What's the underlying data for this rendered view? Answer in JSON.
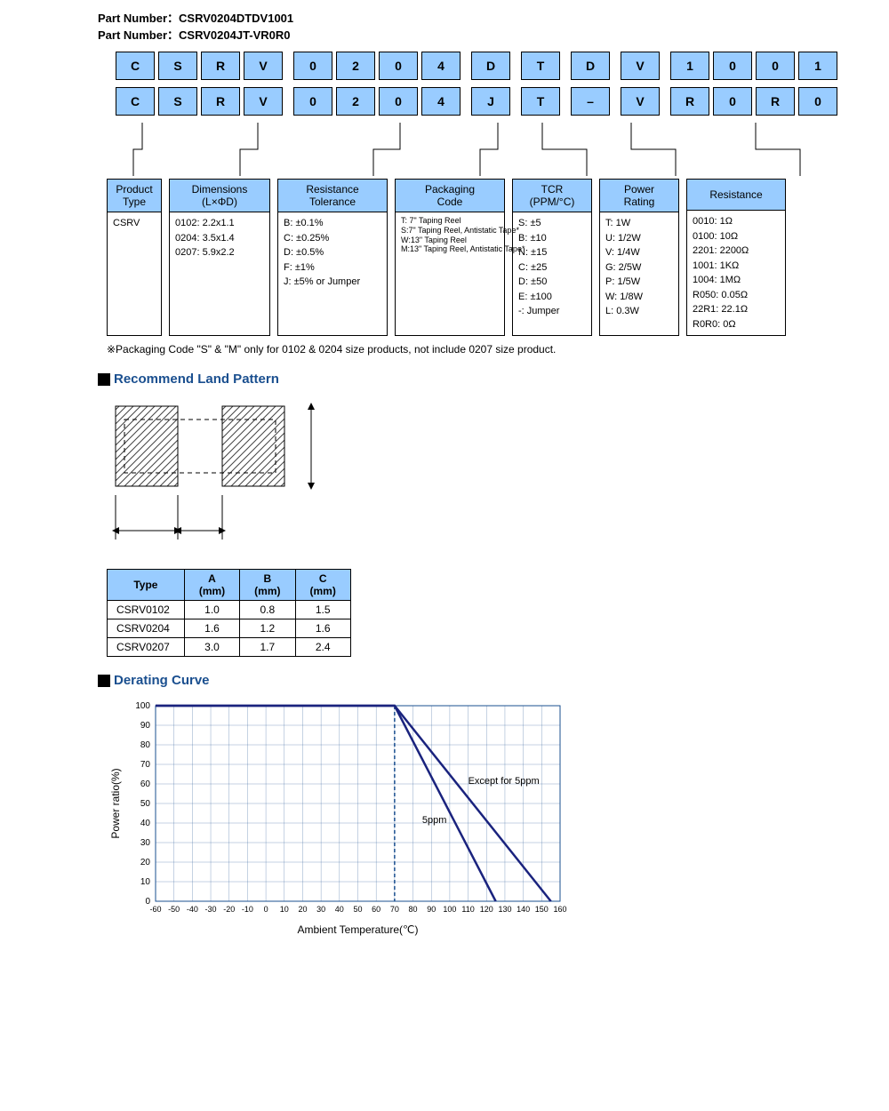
{
  "part1_label": "Part Number：",
  "part1_value": "CSRV0204DTDV1001",
  "part2_label": "Part Number：",
  "part2_value": "CSRV0204JT-VR0R0",
  "code_row1": [
    "C",
    "S",
    "R",
    "V",
    "0",
    "2",
    "0",
    "4",
    "D",
    "T",
    "D",
    "V",
    "1",
    "0",
    "0",
    "1"
  ],
  "code_row2": [
    "C",
    "S",
    "R",
    "V",
    "0",
    "2",
    "0",
    "4",
    "J",
    "T",
    "–",
    "V",
    "R",
    "0",
    "R",
    "0"
  ],
  "sections": {
    "product_type": {
      "head": "Product\nType",
      "body": [
        "CSRV"
      ]
    },
    "dimensions": {
      "head": "Dimensions\n(L×ΦD)",
      "body": [
        "0102: 2.2x1.1",
        "0204: 3.5x1.4",
        "0207: 5.9x2.2"
      ]
    },
    "tolerance": {
      "head": "Resistance\nTolerance",
      "body": [
        "B: ±0.1%",
        "C: ±0.25%",
        "D: ±0.5%",
        "F: ±1%",
        "J: ±5% or Jumper"
      ]
    },
    "packaging": {
      "head": "Packaging\nCode",
      "body": [
        "T: 7\" Taping Reel",
        "S:7\" Taping Reel, Antistatic Tape*",
        "W:13\" Taping Reel",
        "M:13\" Taping Reel, Antistatic Tape*"
      ]
    },
    "tcr": {
      "head": "TCR\n(PPM/°C)",
      "body": [
        "S: ±5",
        "B: ±10",
        "N: ±15",
        "C: ±25",
        "D: ±50",
        "E: ±100",
        "-: Jumper"
      ]
    },
    "power": {
      "head": "Power\nRating",
      "body": [
        "T: 1W",
        "U: 1/2W",
        "V: 1/4W",
        "G: 2/5W",
        "P: 1/5W",
        "W: 1/8W",
        "L: 0.3W"
      ]
    },
    "resistance": {
      "head": "Resistance",
      "body": [
        "0010: 1Ω",
        "0100: 10Ω",
        "2201: 2200Ω",
        "1001: 1KΩ",
        "1004: 1MΩ",
        "R050: 0.05Ω",
        "22R1: 22.1Ω",
        "R0R0: 0Ω"
      ]
    }
  },
  "note": "※Packaging Code \"S\" & \"M\" only for 0102 & 0204 size products, not include 0207 size product.",
  "land_title": "Recommend Land Pattern",
  "land_table": {
    "headers": [
      "Type",
      "A\n(mm)",
      "B\n(mm)",
      "C\n(mm)"
    ],
    "rows": [
      [
        "CSRV0102",
        "1.0",
        "0.8",
        "1.5"
      ],
      [
        "CSRV0204",
        "1.6",
        "1.2",
        "1.6"
      ],
      [
        "CSRV0207",
        "3.0",
        "1.7",
        "2.4"
      ]
    ]
  },
  "derating_title": "Derating Curve",
  "chart_data": {
    "type": "line",
    "title": "",
    "xlabel": "Ambient Temperature(℃)",
    "ylabel": "Power ratio(%)",
    "xlim": [
      -60,
      160
    ],
    "ylim": [
      0,
      100
    ],
    "xticks": [
      -60,
      -50,
      -40,
      -30,
      -20,
      -10,
      0,
      10,
      20,
      30,
      40,
      50,
      60,
      70,
      80,
      90,
      100,
      110,
      120,
      130,
      140,
      150,
      160
    ],
    "yticks": [
      0,
      10,
      20,
      30,
      40,
      50,
      60,
      70,
      80,
      90,
      100
    ],
    "annotations": [
      {
        "text": "Except for 5ppm",
        "x": 110,
        "y": 60
      },
      {
        "text": "5ppm",
        "x": 85,
        "y": 40
      }
    ],
    "series": [
      {
        "name": "Except for 5ppm",
        "x": [
          -60,
          70,
          155
        ],
        "y": [
          100,
          100,
          0
        ]
      },
      {
        "name": "5ppm",
        "x": [
          -60,
          70,
          125
        ],
        "y": [
          100,
          100,
          0
        ]
      }
    ]
  }
}
